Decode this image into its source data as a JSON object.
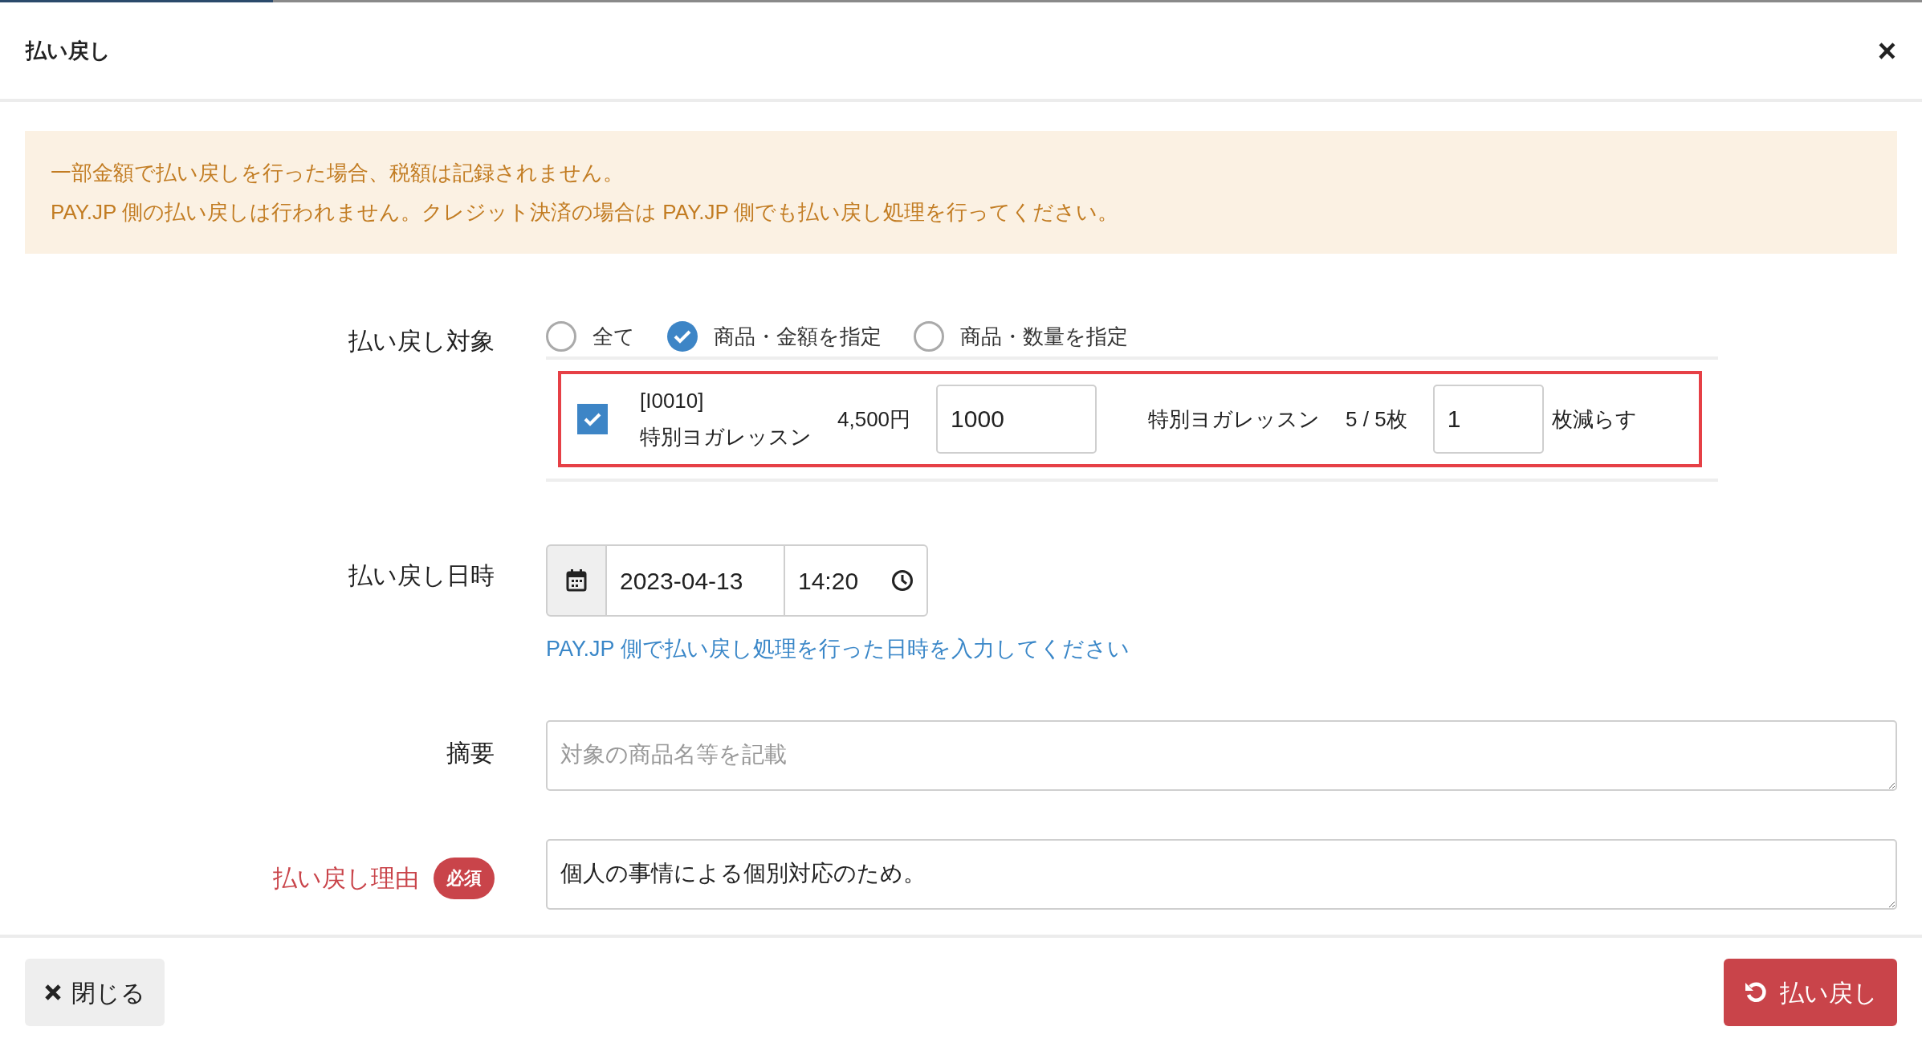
{
  "progress": {
    "level": 0.142
  },
  "dialog": {
    "title": "払い戻し",
    "close_glyph": "×"
  },
  "notice": [
    "一部金額で払い戻しを行った場合、税額は記録されません。",
    "PAY.JP 側の払い戻しは行われません。クレジット決済の場合は PAY.JP 側でも払い戻し処理を行ってください。"
  ],
  "target": {
    "label": "払い戻し対象",
    "options": [
      {
        "label": "全て",
        "selected": false
      },
      {
        "label": "商品・金額を指定",
        "selected": true
      },
      {
        "label": "商品・数量を指定",
        "selected": false
      }
    ],
    "items": [
      {
        "checked": true,
        "code": "[I0010]",
        "name": "特別ヨガレッスン",
        "price": "4,500円",
        "amount": "1000",
        "ticket_name": "特別ヨガレッスン",
        "stock": "5 / 5枚",
        "reduce": "1",
        "reduce_suffix": "枚減らす"
      }
    ]
  },
  "datetime": {
    "label": "払い戻し日時",
    "date": "2023-04-13",
    "time": "14:20",
    "help": "PAY.JP 側で払い戻し処理を行った日時を入力してください"
  },
  "summary": {
    "label": "摘要",
    "placeholder": "対象の商品名等を記載"
  },
  "reason": {
    "label": "払い戻し理由",
    "badge": "必須",
    "value": "個人の事情による個別対応のため。"
  },
  "footer": {
    "close": "閉じる",
    "submit": "払い戻し"
  }
}
